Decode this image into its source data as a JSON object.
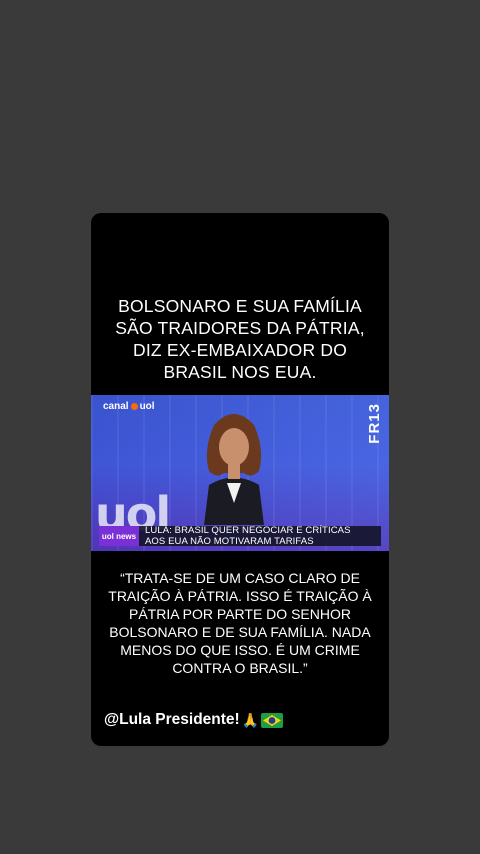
{
  "post": {
    "headline": "BOLSONARO E SUA FAMÍLIA\nSÃO TRAIDORES  DA PÁTRIA,\nDIZ EX-EMBAIXADOR DO\nBRASIL NOS EUA.",
    "video": {
      "channel_logo": "canal",
      "channel_logo_suffix": "uol",
      "corner_tag": "FR13",
      "background_text": "uol",
      "lower_third_brand": "uol news",
      "lower_third_text": "LULA: BRASIL QUER NEGOCIAR E CRÍTICAS\nAOS EUA NÃO MOTIVARAM TARIFAS"
    },
    "quote": "“TRATA-SE DE UM CASO CLARO DE\nTRAIÇÃO À PÁTRIA. ISSO É TRAIÇÃO À\nPÁTRIA POR PARTE DO SENHOR\nBOLSONARO E DE SUA FAMÍLIA. NADA\nMENOS DO QUE ISSO. É UM CRIME\nCONTRA O BRASIL.”",
    "handle": "@Lula Presidente!",
    "handle_emojis": [
      "folded-hands",
      "brazil-flag"
    ]
  },
  "colors": {
    "page_bg": "#3a3a3a",
    "card_bg": "#000000",
    "video_blue": "#3b56e0",
    "brand_purple": "#7b2fd6"
  }
}
